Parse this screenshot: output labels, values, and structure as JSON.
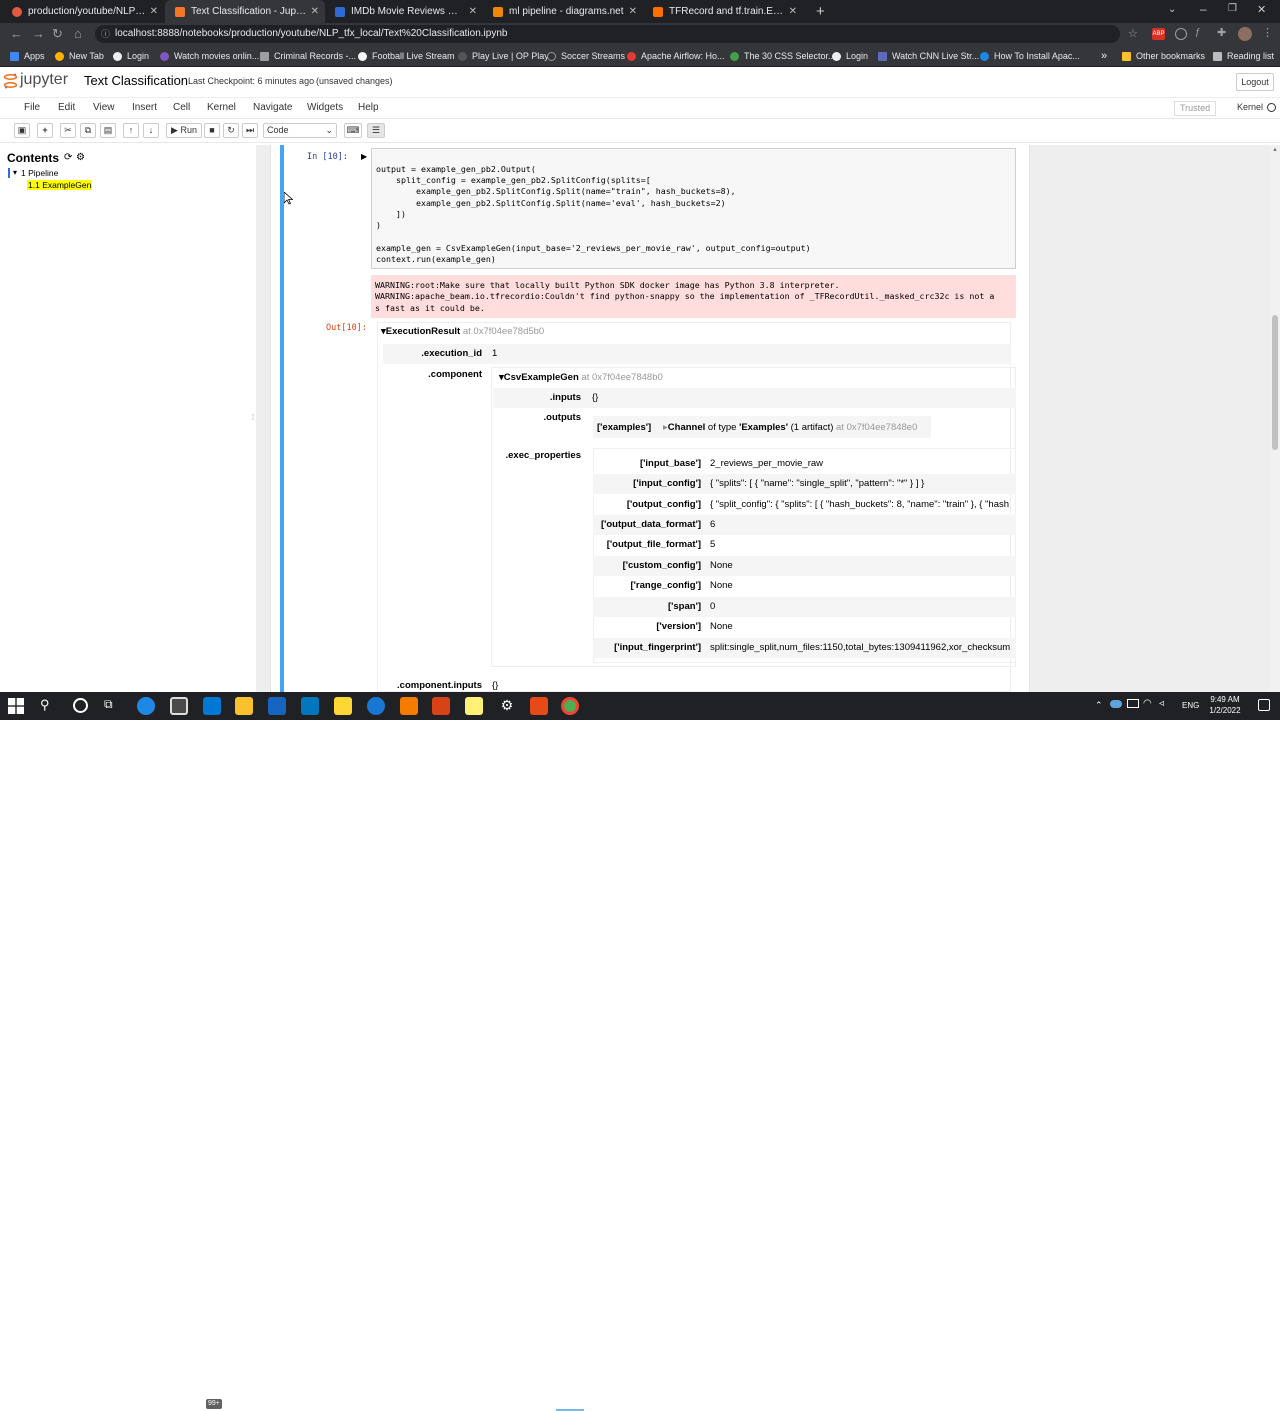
{
  "browser": {
    "tabs": [
      {
        "title": "production/youtube/NLP_tfx_lo",
        "color": "#e25a3f"
      },
      {
        "title": "Text Classification - Jupyter Note",
        "color": "#f37726"
      },
      {
        "title": "IMDb Movie Reviews Dataset | IE",
        "color": "#2d6ad6"
      },
      {
        "title": "ml pipeline - diagrams.net",
        "color": "#f08705"
      },
      {
        "title": "TFRecord and tf.train.Example |",
        "color": "#ff6f00"
      }
    ],
    "new_tab": "+",
    "url": "localhost:8888/notebooks/production/youtube/NLP_tfx_local/Text%20Classification.ipynb",
    "bookmarks": [
      "Apps",
      "New Tab",
      "Login",
      "Watch movies onlin...",
      "Criminal Records -...",
      "Football Live Stream",
      "Play Live | OP Play",
      "Soccer Streams",
      "Apache Airflow: Ho...",
      "The 30 CSS Selector...",
      "Login",
      "Watch CNN Live Str...",
      "How To Install Apac...",
      "»",
      "Other bookmarks",
      "Reading list"
    ]
  },
  "jupyter": {
    "logo": "jupyter",
    "title": "Text Classification",
    "checkpoint": "Last Checkpoint: 6 minutes ago",
    "unsaved": "(unsaved changes)",
    "logout": "Logout",
    "menu": [
      "File",
      "Edit",
      "View",
      "Insert",
      "Cell",
      "Kernel",
      "Navigate",
      "Widgets",
      "Help"
    ],
    "trusted": "Trusted",
    "kernel": "Kernel",
    "run": "Run",
    "cell_type": "Code"
  },
  "toc": {
    "title": "Contents",
    "items": [
      {
        "num": "1",
        "label": "Pipeline"
      },
      {
        "num": "1.1",
        "label": "ExampleGen"
      }
    ]
  },
  "cell": {
    "in_prompt": "In [10]:",
    "out_prompt": "Out[10]:",
    "code": [
      "output = example_gen_pb2.Output(",
      "    split_config = example_gen_pb2.SplitConfig(splits=[",
      "        example_gen_pb2.SplitConfig.Split(name=\"train\", hash_buckets=8),",
      "        example_gen_pb2.SplitConfig.Split(name='eval', hash_buckets=2)",
      "    ])",
      ")",
      "",
      "example_gen = CsvExampleGen(input_base='2_reviews_per_movie_raw', output_config=output)",
      "context.run(example_gen)"
    ],
    "warning": [
      "WARNING:root:Make sure that locally built Python SDK docker image has Python 3.8 interpreter.",
      "WARNING:apache_beam.io.tfrecordio:Couldn't find python-snappy so the implementation of _TFRecordUtil._masked_crc32c is not a",
      "s fast as it could be."
    ]
  },
  "result": {
    "title": "ExecutionResult",
    "title_at": "at 0x7f04ee78d5b0",
    "execution_id_key": ".execution_id",
    "execution_id": "1",
    "component_key": ".component",
    "component_title": "CsvExampleGen",
    "component_at": "at 0x7f04ee7848b0",
    "inputs_key": ".inputs",
    "inputs_val": "{}",
    "outputs_key": ".outputs",
    "outputs_examples": "['examples']",
    "channel_label": "Channel",
    "channel_of": "of type",
    "channel_type": "'Examples'",
    "channel_count": "(1 artifact)",
    "channel_at": "at 0x7f04ee7848e0",
    "exec_key": ".exec_properties",
    "props": [
      {
        "k": "['input_base']",
        "v": "2_reviews_per_movie_raw"
      },
      {
        "k": "['input_config']",
        "v": "{ \"splits\": [ { \"name\": \"single_split\", \"pattern\": \"*\" } ] }"
      },
      {
        "k": "['output_config']",
        "v": "{ \"split_config\": { \"splits\": [ { \"hash_buckets\": 8, \"name\": \"train\" }, { \"hash"
      },
      {
        "k": "['output_data_format']",
        "v": "6"
      },
      {
        "k": "['output_file_format']",
        "v": "5"
      },
      {
        "k": "['custom_config']",
        "v": "None"
      },
      {
        "k": "['range_config']",
        "v": "None"
      },
      {
        "k": "['span']",
        "v": "0"
      },
      {
        "k": "['version']",
        "v": "None"
      },
      {
        "k": "['input_fingerprint']",
        "v": "split:single_split,num_files:1150,total_bytes:1309411962,xor_checksum"
      }
    ],
    "component_inputs_key": ".component.inputs",
    "component_inputs_val": "{}"
  },
  "taskbar": {
    "time": "9:49 AM",
    "date": "1/2/2022",
    "lang": "ENG",
    "badge": "99+"
  }
}
